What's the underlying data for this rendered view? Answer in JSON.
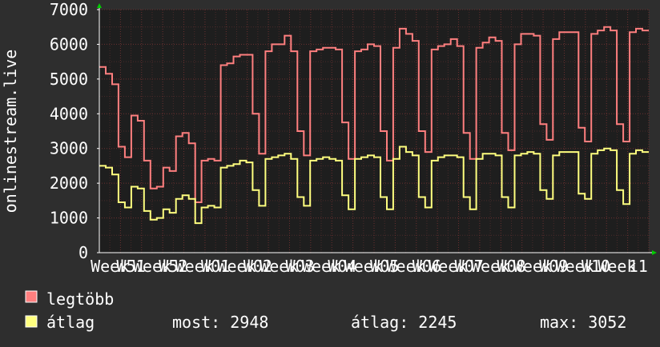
{
  "chart_data": {
    "type": "line",
    "ylabel": "onlinestream.live",
    "ylim": [
      0,
      7000
    ],
    "yticks": [
      "0",
      "1000",
      "2000",
      "3000",
      "4000",
      "5000",
      "6000",
      "7000"
    ],
    "xticks": [
      "Week",
      "W51",
      "Week",
      "W52",
      "Week",
      "W01",
      "Week",
      "W02",
      "Week",
      "W03",
      "Week",
      "W04",
      "Week",
      "W05",
      "Week",
      "W06",
      "Week",
      "W07",
      "Week",
      "W08",
      "Week",
      "W09",
      "Week",
      "W10",
      "Week",
      "11"
    ],
    "grid": true,
    "colors": {
      "background": "#2e2e2e",
      "plot_background": "#1e1e1e",
      "grid_major": "#6b3030",
      "grid_minor": "#4a2a2a",
      "axis": "#ffffff",
      "legtobb": "#ff7f7f",
      "atlag": "#ffff7f"
    },
    "series": [
      {
        "name": "legtöbb",
        "color": "#ff7f7f",
        "values": [
          5350,
          5150,
          4850,
          3050,
          2750,
          3950,
          3800,
          2650,
          1850,
          1900,
          2450,
          2350,
          3350,
          3450,
          3150,
          1450,
          2650,
          2700,
          2650,
          5400,
          5450,
          5650,
          5700,
          5700,
          4000,
          2850,
          5800,
          6000,
          6000,
          6250,
          5800,
          3500,
          2800,
          5800,
          5850,
          5900,
          5900,
          5850,
          3750,
          2700,
          5800,
          5850,
          6000,
          5950,
          3500,
          2650,
          5900,
          6450,
          6300,
          6100,
          3500,
          2900,
          5850,
          5950,
          6000,
          6150,
          5950,
          3450,
          2700,
          5900,
          6050,
          6200,
          6100,
          3450,
          2950,
          6000,
          6300,
          6300,
          6250,
          3700,
          3250,
          6150,
          6350,
          6350,
          6350,
          3600,
          3200,
          6300,
          6400,
          6500,
          6400,
          3700,
          3200,
          6350,
          6450,
          6400
        ]
      },
      {
        "name": "átlag",
        "color": "#ffff7f",
        "values": [
          2500,
          2450,
          2250,
          1450,
          1300,
          1900,
          1850,
          1200,
          950,
          1000,
          1250,
          1150,
          1550,
          1650,
          1550,
          850,
          1300,
          1350,
          1300,
          2450,
          2500,
          2550,
          2650,
          2600,
          1800,
          1350,
          2700,
          2750,
          2800,
          2850,
          2700,
          1600,
          1350,
          2650,
          2700,
          2750,
          2700,
          2650,
          1650,
          1250,
          2700,
          2750,
          2800,
          2750,
          1600,
          1250,
          2700,
          3050,
          2900,
          2800,
          1600,
          1300,
          2650,
          2750,
          2800,
          2800,
          2750,
          1600,
          1250,
          2700,
          2850,
          2850,
          2800,
          1600,
          1300,
          2800,
          2850,
          2900,
          2850,
          1800,
          1550,
          2800,
          2900,
          2900,
          2900,
          1700,
          1550,
          2850,
          2950,
          3000,
          2950,
          1800,
          1400,
          2850,
          2950,
          2900
        ]
      }
    ]
  },
  "legend": {
    "items": [
      {
        "label": "legtöbb",
        "color": "#ff7f7f"
      },
      {
        "label": "átlag",
        "color": "#ffff7f"
      }
    ],
    "stats": {
      "most": "most: 2948",
      "atlag": "átlag: 2245",
      "max": "max: 3052"
    }
  }
}
